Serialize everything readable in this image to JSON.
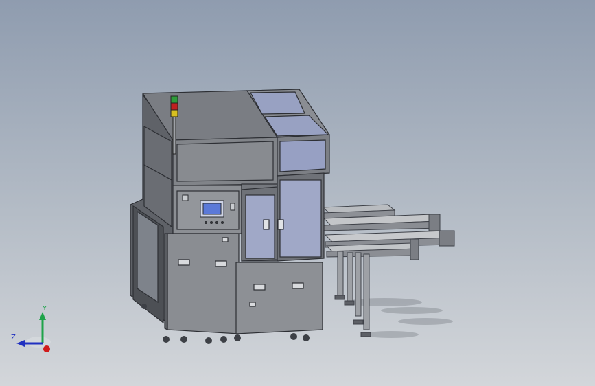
{
  "viewport": {
    "background_top": "#8f9caf",
    "background_bottom": "#d3d6da"
  },
  "model": {
    "description_icon": "machine-assembly-icon",
    "frame_color": "#6f7278",
    "panel_color": "#8a8d92",
    "window_color": "#9ea7c7",
    "signal_tower": {
      "green": "#2e9b3a",
      "red": "#c02020",
      "yellow": "#d8c020"
    }
  },
  "triad": {
    "x_label": "",
    "y_label": "Y",
    "z_label": "Z",
    "y_color": "#1fa34a",
    "z_color": "#2030c0",
    "x_color": "#d01c1c"
  }
}
